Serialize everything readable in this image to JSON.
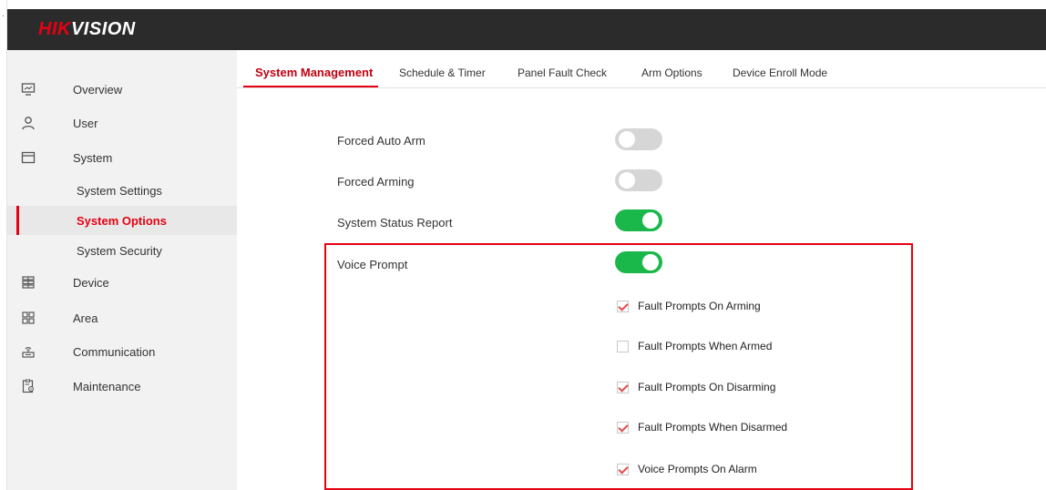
{
  "brand": {
    "logo_red": "HIK",
    "logo_white": "VISION"
  },
  "sidebar": {
    "items": [
      {
        "label": "Overview",
        "icon": "monitor-icon"
      },
      {
        "label": "User",
        "icon": "user-icon"
      },
      {
        "label": "System",
        "icon": "window-icon"
      },
      {
        "label": "Device",
        "icon": "device-icon"
      },
      {
        "label": "Area",
        "icon": "grid-icon"
      },
      {
        "label": "Communication",
        "icon": "network-icon"
      },
      {
        "label": "Maintenance",
        "icon": "maintenance-icon"
      }
    ],
    "system_sub": [
      {
        "label": "System Settings",
        "active": false
      },
      {
        "label": "System Options",
        "active": true
      },
      {
        "label": "System Security",
        "active": false
      }
    ]
  },
  "tabs": [
    {
      "label": "System Management",
      "active": true
    },
    {
      "label": "Schedule & Timer",
      "active": false
    },
    {
      "label": "Panel Fault Check",
      "active": false
    },
    {
      "label": "Arm Options",
      "active": false
    },
    {
      "label": "Device Enroll Mode",
      "active": false
    }
  ],
  "settings": [
    {
      "label": "Forced Auto Arm",
      "state": "off"
    },
    {
      "label": "Forced Arming",
      "state": "off"
    },
    {
      "label": "System Status Report",
      "state": "on"
    },
    {
      "label": "Voice Prompt",
      "state": "on"
    }
  ],
  "voice_options": [
    {
      "label": "Fault Prompts On Arming",
      "checked": true
    },
    {
      "label": "Fault Prompts When Armed",
      "checked": false
    },
    {
      "label": "Fault Prompts On Disarming",
      "checked": true
    },
    {
      "label": "Fault Prompts When Disarmed",
      "checked": true
    },
    {
      "label": "Voice Prompts On Alarm",
      "checked": true
    }
  ],
  "colors": {
    "accent": "#e60012",
    "toggle_on": "#1ab84a",
    "toggle_off": "#d6d6d6",
    "header": "#2b2b2b",
    "sidebar_bg": "#f2f2f2"
  }
}
